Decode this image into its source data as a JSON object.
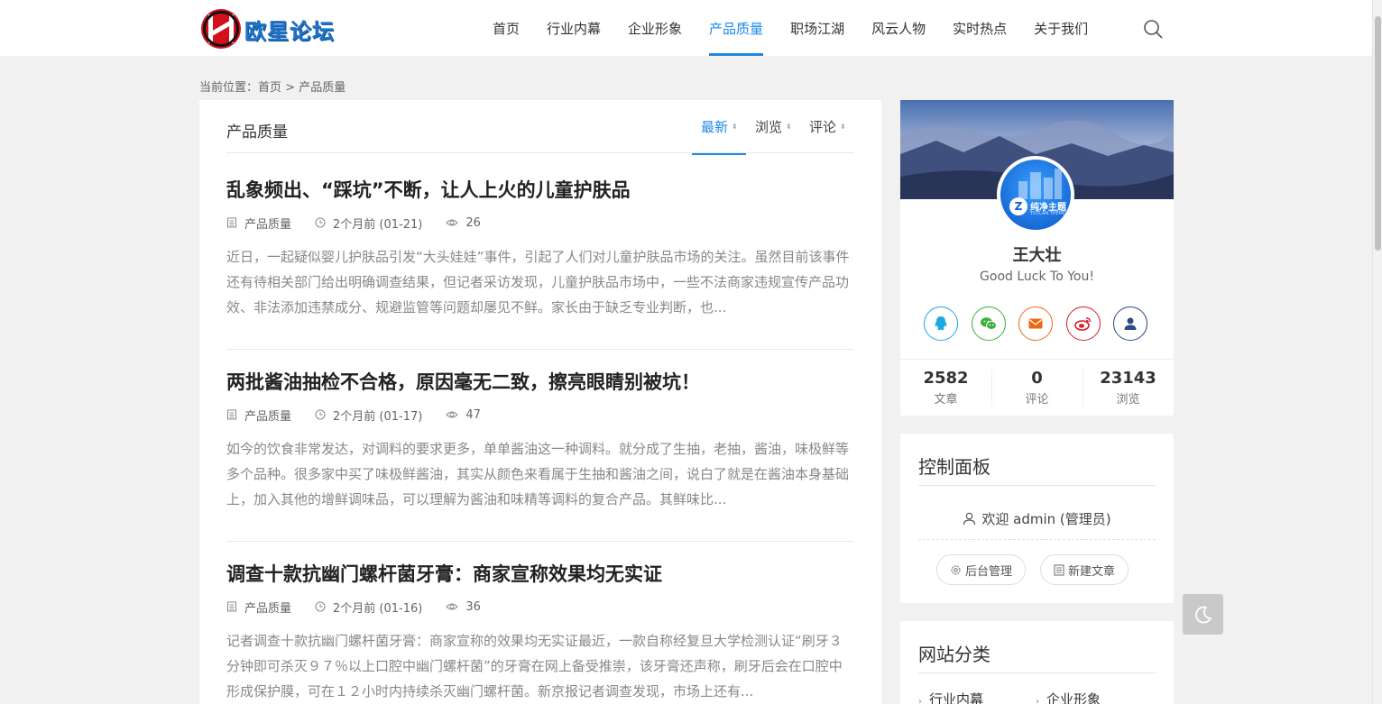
{
  "header": {
    "logo_text": "欧星论坛",
    "nav": [
      {
        "label": "首页",
        "active": false
      },
      {
        "label": "行业内幕",
        "active": false
      },
      {
        "label": "企业形象",
        "active": false
      },
      {
        "label": "产品质量",
        "active": true
      },
      {
        "label": "职场江湖",
        "active": false
      },
      {
        "label": "风云人物",
        "active": false
      },
      {
        "label": "实时热点",
        "active": false
      },
      {
        "label": "关于我们",
        "active": false
      }
    ],
    "search_icon": "search-icon"
  },
  "breadcrumb": {
    "prefix": "当前位置：",
    "home": "首页",
    "separator": " > ",
    "current": "产品质量"
  },
  "main": {
    "title": "产品质量",
    "sort": [
      {
        "label": "最新",
        "active": true
      },
      {
        "label": "浏览",
        "active": false
      },
      {
        "label": "评论",
        "active": false
      }
    ],
    "posts": [
      {
        "title": "乱象频出、“踩坑”不断，让人上火的儿童护肤品",
        "category": "产品质量",
        "time": "2个月前 (01-21)",
        "views": "26",
        "excerpt": "近日，一起疑似婴儿护肤品引发“大头娃娃”事件，引起了人们对儿童护肤品市场的关注。虽然目前该事件还有待相关部门给出明确调查结果，但记者采访发现，儿童护肤品市场中，一些不法商家违规宣传产品功效、非法添加违禁成分、规避监管等问题却屡见不鲜。家长由于缺乏专业判断，也..."
      },
      {
        "title": "两批酱油抽检不合格，原因毫无二致，擦亮眼睛别被坑！",
        "category": "产品质量",
        "time": "2个月前 (01-17)",
        "views": "47",
        "excerpt": "如今的饮食非常发达，对调料的要求更多，单单酱油这一种调料。就分成了生抽，老抽，酱油，味极鲜等多个品种。很多家中买了味极鲜酱油，其实从颜色来看属于生抽和酱油之间，说白了就是在酱油本身基础上，加入其他的增鲜调味品，可以理解为酱油和味精等调料的复合产品。其鲜味比..."
      },
      {
        "title": "调查十款抗幽门螺杆菌牙膏：商家宣称效果均无实证",
        "category": "产品质量",
        "time": "2个月前 (01-16)",
        "views": "36",
        "excerpt": "记者调查十款抗幽门螺杆菌牙膏：商家宣称的效果均无实证最近，一款自称经复旦大学检测认证“刷牙３分钟即可杀灭９７％以上口腔中幽门螺杆菌”的牙膏在网上备受推崇，该牙膏还声称，刷牙后会在口腔中形成保护膜，可在１２小时内持续杀灭幽门螺杆菌。新京报记者调查发现，市场上还有..."
      }
    ]
  },
  "profile": {
    "avatar_label": "纯净主题",
    "avatar_sub": "TOTLAN THEME",
    "name": "王大壮",
    "motto": "Good Luck To You!",
    "socials": [
      {
        "icon": "qq-icon",
        "color": "#1ca8e0"
      },
      {
        "icon": "wechat-icon",
        "color": "#3cb034"
      },
      {
        "icon": "email-icon",
        "color": "#ec6a16"
      },
      {
        "icon": "weibo-icon",
        "color": "#d81e2a"
      },
      {
        "icon": "user-icon",
        "color": "#2a4b86"
      }
    ],
    "stats": [
      {
        "num": "2582",
        "label": "文章"
      },
      {
        "num": "0",
        "label": "评论"
      },
      {
        "num": "23143",
        "label": "浏览"
      }
    ]
  },
  "control_panel": {
    "title": "控制面板",
    "welcome": "欢迎 admin (管理员)",
    "admin_button": "后台管理",
    "new_post_button": "新建文章"
  },
  "categories": {
    "title": "网站分类",
    "items": [
      "行业内幕",
      "企业形象"
    ]
  },
  "float_button_icon": "moon-icon"
}
